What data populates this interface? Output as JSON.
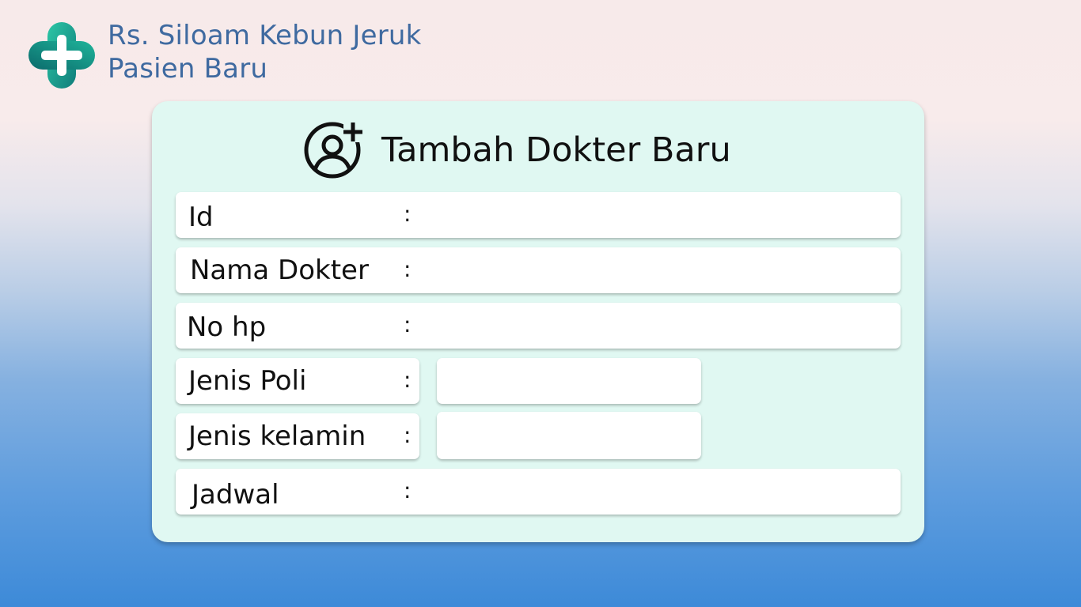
{
  "header": {
    "hospital_name": "Rs. Siloam Kebun Jeruk",
    "page_subtitle": "Pasien Baru",
    "logo_icon": "medical-cross-icon"
  },
  "form": {
    "title": "Tambah Dokter Baru",
    "title_icon": "user-plus-icon",
    "colon": ":",
    "fields": [
      {
        "label": "Id",
        "value": ""
      },
      {
        "label": "Nama Dokter",
        "value": ""
      },
      {
        "label": "No hp",
        "value": ""
      },
      {
        "label": "Jenis Poli",
        "value": ""
      },
      {
        "label": "Jenis kelamin",
        "value": ""
      },
      {
        "label": "Jadwal",
        "value": ""
      }
    ]
  },
  "colors": {
    "header_text": "#3f6aa0",
    "card_background": "#e0f8f2",
    "logo_teal": "#1aa78a"
  }
}
